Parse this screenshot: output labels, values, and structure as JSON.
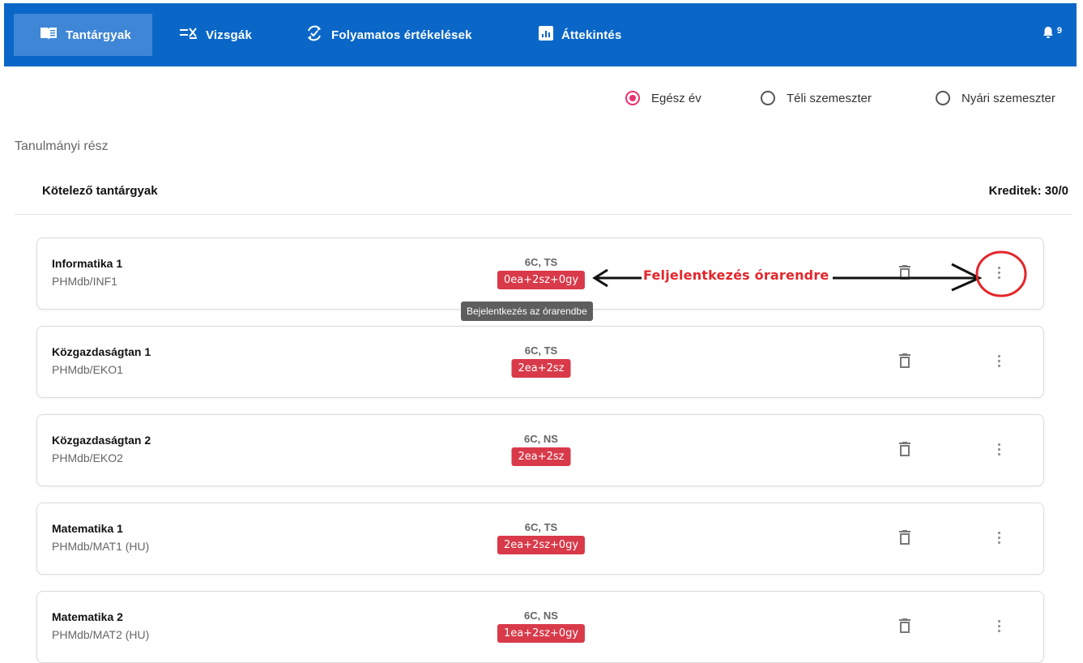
{
  "nav": {
    "items": [
      {
        "label": "Tantárgyak",
        "icon": "book-icon",
        "active": true
      },
      {
        "label": "Vizsgák",
        "icon": "exam-list-icon",
        "active": false
      },
      {
        "label": "Folyamatos értékelések",
        "icon": "refresh-check-icon",
        "active": false
      },
      {
        "label": "Áttekintés",
        "icon": "chart-icon",
        "active": false
      }
    ],
    "notification_count": "9"
  },
  "filters": {
    "options": [
      {
        "label": "Egész év",
        "checked": true
      },
      {
        "label": "Téli szemeszter",
        "checked": false
      },
      {
        "label": "Nyári szemeszter",
        "checked": false
      }
    ]
  },
  "section_title": "Tanulmányi rész",
  "group": {
    "title": "Kötelező tantárgyak",
    "credits": "Kreditek: 30/0"
  },
  "courses": [
    {
      "name": "Informatika 1",
      "code": "PHMdb/INF1",
      "meta": "6C, TS",
      "badge": "0ea+2sz+0gy"
    },
    {
      "name": "Közgazdaságtan 1",
      "code": "PHMdb/EKO1",
      "meta": "6C, TS",
      "badge": "2ea+2sz"
    },
    {
      "name": "Közgazdaságtan 2",
      "code": "PHMdb/EKO2",
      "meta": "6C, NS",
      "badge": "2ea+2sz"
    },
    {
      "name": "Matematika 1",
      "code": "PHMdb/MAT1 (HU)",
      "meta": "6C, TS",
      "badge": "2ea+2sz+0gy"
    },
    {
      "name": "Matematika 2",
      "code": "PHMdb/MAT2 (HU)",
      "meta": "6C, NS",
      "badge": "1ea+2sz+0gy"
    }
  ],
  "tooltip": "Bejelentkezés az órarendbe",
  "annotation": {
    "text": "Feljelentkezés órarendre",
    "color": "#e3262b"
  },
  "colors": {
    "nav_bg": "#0a67c8",
    "nav_active": "#3f86d6",
    "radio_accent": "#e8336d",
    "badge_bg": "#d83a4a"
  }
}
